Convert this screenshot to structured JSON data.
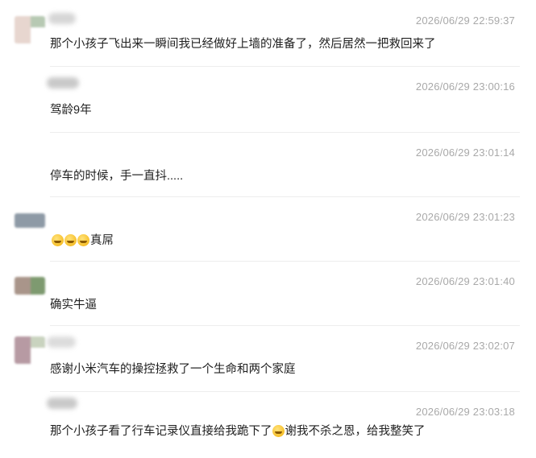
{
  "comments": [
    {
      "time": "2026/06/29 22:59:37",
      "text": "那个小孩子飞出来一瞬间我已经做好上墙的准备了，然后居然一把救回来了",
      "avatar_colors": [
        "#e7d6cf",
        "#b7c9b3"
      ]
    },
    {
      "time": "2026/06/29 23:00:16",
      "text": "驾龄9年",
      "avatar_colors": [
        "#ffffff",
        "#ffffff"
      ]
    },
    {
      "time": "2026/06/29 23:01:14",
      "text": "停车的时候，手一直抖.....",
      "avatar_colors": [
        "#ffffff",
        "#ffffff"
      ]
    },
    {
      "time": "2026/06/29 23:01:23",
      "text": "真屌",
      "emoji": "laugh-cry-emoji",
      "emoji_count": 3,
      "avatar_colors": [
        "#8e9aa6",
        "#c7cdd6"
      ]
    },
    {
      "time": "2026/06/29 23:01:40",
      "text": "确实牛逼",
      "avatar_colors": [
        "#a9958a",
        "#7e9a70"
      ]
    },
    {
      "time": "2026/06/29 23:02:07",
      "text": "感谢小米汽车的操控拯救了一个生命和两个家庭",
      "avatar_colors": [
        "#b79aa3",
        "#c9d3bf"
      ]
    },
    {
      "time": "2026/06/29 23:03:18",
      "text_before": "那个小孩子看了行车记录仪直接给我跪下了",
      "emoji": "laugh-cry-emoji",
      "text_after": "谢我不杀之恩，给我整笑了",
      "avatar_colors": [
        "#ffffff",
        "#ffffff"
      ]
    }
  ]
}
